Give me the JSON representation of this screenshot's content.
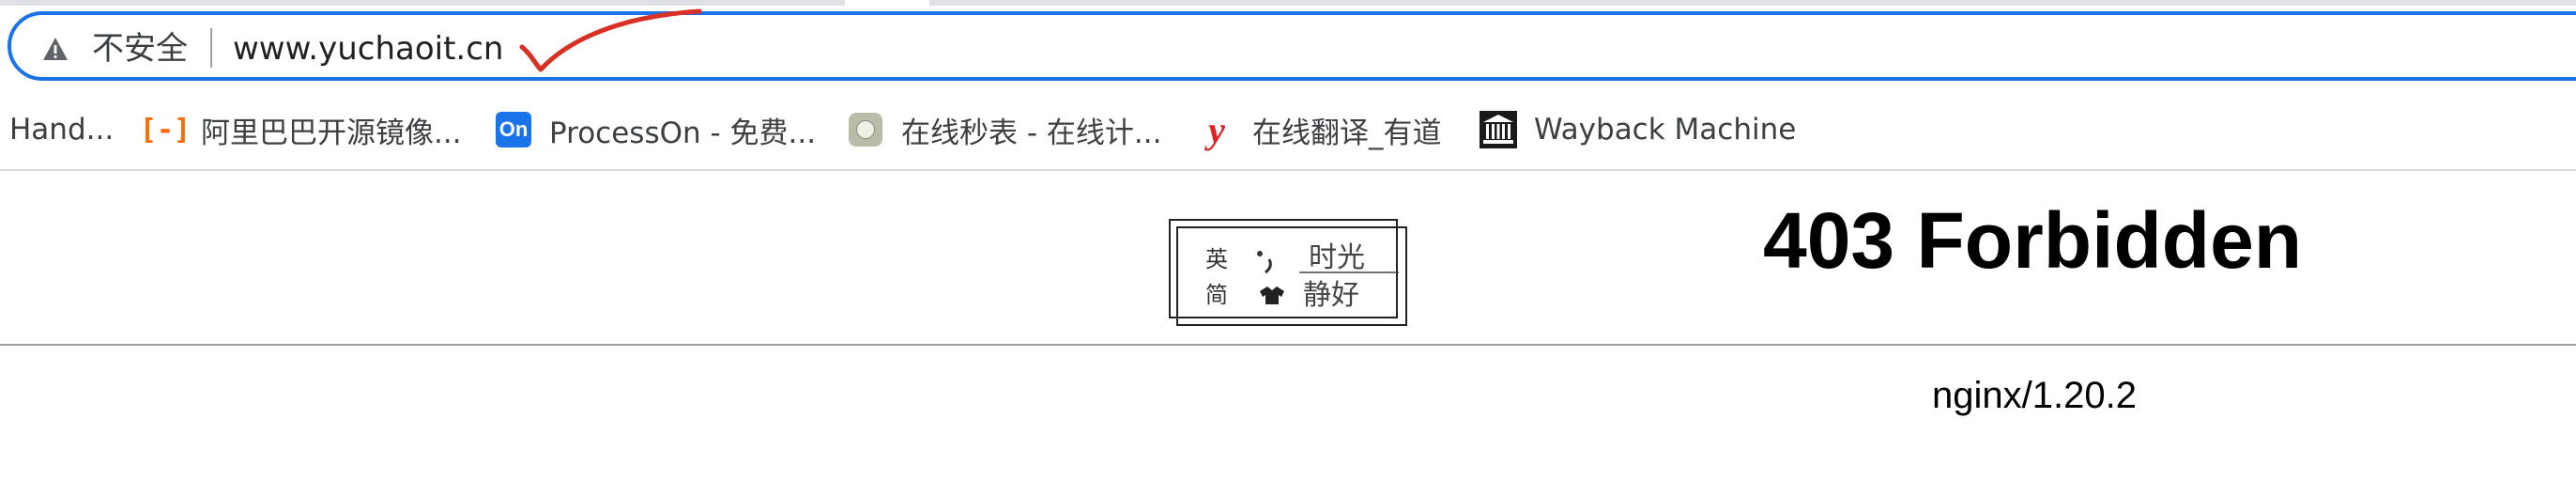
{
  "address_bar": {
    "security_label": "不安全",
    "url": "www.yuchaoit.cn",
    "security_icon": "warning-triangle-icon",
    "annotation_color": "#d93025"
  },
  "bookmarks": [
    {
      "label": "Hand...",
      "icon": "none"
    },
    {
      "label": "阿里巴巴开源镜像...",
      "icon": "aliyun-icon"
    },
    {
      "label": "ProcessOn - 免费...",
      "icon": "processon-icon"
    },
    {
      "label": "在线秒表 - 在线计...",
      "icon": "stopwatch-icon"
    },
    {
      "label": "在线翻译_有道",
      "icon": "youdao-icon"
    },
    {
      "label": "Wayback Machine",
      "icon": "museum-icon"
    }
  ],
  "page": {
    "title": "403 Forbidden",
    "server_signature": "nginx/1.20.2",
    "logo": {
      "left_top": "英",
      "left_bottom": "简",
      "right_text_top": "时光",
      "right_text_bottom": "静好"
    }
  },
  "colors": {
    "focus_ring": "#1a73e8",
    "text": "#3c4043",
    "title": "#000000"
  }
}
